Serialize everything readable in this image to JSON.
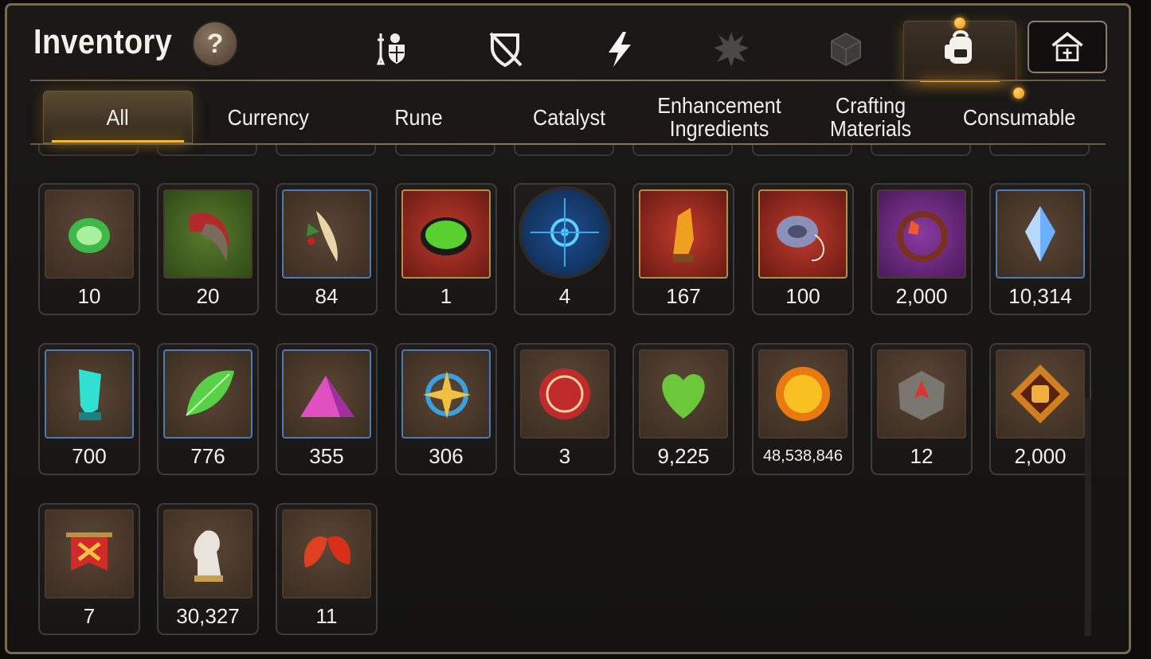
{
  "header": {
    "title": "Inventory",
    "help_label": "?"
  },
  "categories": [
    {
      "icon": "knight-shield-icon"
    },
    {
      "icon": "broken-shield-icon"
    },
    {
      "icon": "lightning-icon"
    },
    {
      "icon": "burst-icon"
    },
    {
      "icon": "cube-icon"
    },
    {
      "icon": "backpack-icon"
    },
    {
      "icon": "house-icon"
    }
  ],
  "tabs": [
    {
      "label": "All"
    },
    {
      "label": "Currency"
    },
    {
      "label": "Rune"
    },
    {
      "label": "Catalyst"
    },
    {
      "label": "Enhancement Ingredients"
    },
    {
      "label": "Crafting Materials"
    },
    {
      "label": "Consumable"
    }
  ],
  "items": [
    {
      "qty": "10",
      "icon": "green-stone-icon",
      "frame": "brown"
    },
    {
      "qty": "20",
      "icon": "claw-icon",
      "frame": "green"
    },
    {
      "qty": "84",
      "icon": "herb-root-icon",
      "frame": "blue"
    },
    {
      "qty": "1",
      "icon": "green-orb-icon",
      "frame": "gold"
    },
    {
      "qty": "4",
      "icon": "blue-rune-circle-icon",
      "frame": "round"
    },
    {
      "qty": "167",
      "icon": "amber-crystal-icon",
      "frame": "gold"
    },
    {
      "qty": "100",
      "icon": "yoyo-icon",
      "frame": "gold"
    },
    {
      "qty": "2,000",
      "icon": "flower-ring-icon",
      "frame": "purple"
    },
    {
      "qty": "10,314",
      "icon": "blue-gem-icon",
      "frame": "blue"
    },
    {
      "qty": "700",
      "icon": "teal-crystal-icon",
      "frame": "blue"
    },
    {
      "qty": "776",
      "icon": "green-leaf-icon",
      "frame": "blue"
    },
    {
      "qty": "355",
      "icon": "pink-powder-icon",
      "frame": "blue"
    },
    {
      "qty": "306",
      "icon": "star-amulet-icon",
      "frame": "blue"
    },
    {
      "qty": "3",
      "icon": "red-seal-icon",
      "frame": "brown"
    },
    {
      "qty": "9,225",
      "icon": "green-heart-icon",
      "frame": "brown"
    },
    {
      "qty": "48,538,846",
      "icon": "gold-coin-icon",
      "frame": "brown"
    },
    {
      "qty": "12",
      "icon": "stone-compass-icon",
      "frame": "brown"
    },
    {
      "qty": "2,000",
      "icon": "fist-emblem-icon",
      "frame": "brown"
    },
    {
      "qty": "7",
      "icon": "red-banner-icon",
      "frame": "brown"
    },
    {
      "qty": "30,327",
      "icon": "chess-knight-icon",
      "frame": "brown"
    },
    {
      "qty": "11",
      "icon": "red-leaves-icon",
      "frame": "brown"
    }
  ]
}
